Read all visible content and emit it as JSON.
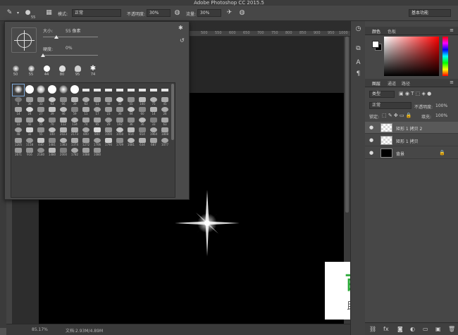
{
  "title": "Adobe Photoshop CC 2015.5",
  "options": {
    "brush_size": "55",
    "mode_label": "模式:",
    "mode_value": "正常",
    "opacity_label": "不透明度:",
    "opacity_value": "30%",
    "flow_label": "流量:",
    "flow_value": "30%",
    "workspace": "基本功能"
  },
  "rulers": {
    "marks": [
      "500",
      "550",
      "600",
      "650",
      "700",
      "750",
      "800",
      "850",
      "900",
      "950",
      "1000"
    ]
  },
  "brush_picker": {
    "size_label": "大小:",
    "size_value": "55 像素",
    "hardness_label": "硬度:",
    "hardness_value": "0%",
    "recent": [
      "50",
      "55",
      "44",
      "80",
      "95",
      "74"
    ],
    "grid_numbers": [
      "6",
      "36",
      "33",
      "63",
      "66",
      "39",
      "63",
      "11",
      "48",
      "32",
      "55",
      "100",
      "75",
      "45",
      "14",
      "24",
      "27",
      "39",
      "46",
      "59",
      "11",
      "17",
      "23",
      "36",
      "44",
      "60",
      "14",
      "26",
      "33",
      "42",
      "55",
      "70",
      "112",
      "134",
      "74",
      "95",
      "29",
      "192",
      "36",
      "36",
      "33",
      "63",
      "48",
      "32",
      "55",
      "100",
      "2023",
      "2173",
      "800",
      "800",
      "1000",
      "1050",
      "814",
      "814",
      "1964",
      "1808",
      "1205",
      "1158",
      "440",
      "1481",
      "1383",
      "1374",
      "1272",
      "1706",
      "1790",
      "1709",
      "1681",
      "634",
      "687",
      "1077",
      "1671",
      "916",
      "2180",
      "1480",
      "2000",
      "1782",
      "1088",
      "1080"
    ]
  },
  "status": {
    "zoom": "85.17%",
    "doc": "文档:2.93M/4.89M"
  },
  "color_panel": {
    "tabs": [
      "颜色",
      "色板"
    ]
  },
  "layers_panel": {
    "tabs": [
      "图层",
      "通道",
      "路径"
    ],
    "kind": "类型",
    "blend": "正常",
    "opacity_label": "不透明度:",
    "opacity_value": "100%",
    "lock_label": "锁定:",
    "fill_label": "填充:",
    "fill_value": "100%",
    "layers": [
      {
        "name": "矩形 1 拷贝 2",
        "selected": true,
        "thumb": "transparent"
      },
      {
        "name": "矩形 1 拷贝",
        "selected": false,
        "thumb": "transparent"
      },
      {
        "name": "背景",
        "selected": false,
        "thumb": "black",
        "locked": true
      }
    ]
  },
  "watermark": {
    "title": "百科全说",
    "subtitle": "助你轻松解决"
  },
  "colors": {
    "foreground": "#ffffff",
    "background": "#000000",
    "watermark_green": "#2aa837"
  }
}
